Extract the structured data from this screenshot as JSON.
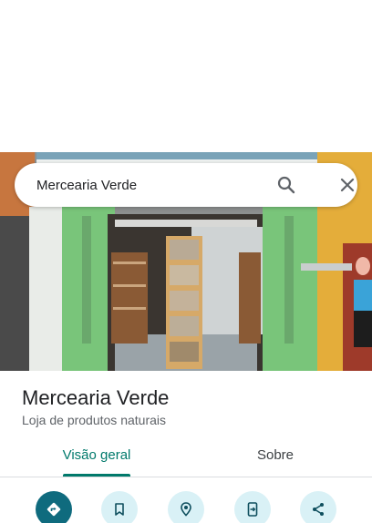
{
  "search": {
    "query": "Mercearia Verde"
  },
  "place": {
    "name": "Mercearia Verde",
    "category": "Loja de produtos naturais"
  },
  "tabs": [
    {
      "label": "Visão geral",
      "active": true
    },
    {
      "label": "Sobre",
      "active": false
    }
  ],
  "actions": [
    {
      "icon": "directions-icon"
    },
    {
      "icon": "save-bookmark-icon"
    },
    {
      "icon": "nearby-pin-icon"
    },
    {
      "icon": "send-to-phone-icon"
    },
    {
      "icon": "share-icon"
    }
  ],
  "colors": {
    "accent": "#00796b",
    "primary_action": "#0f6b7e",
    "action_background": "#d9f1f6",
    "storefront_green": "#6fbf73"
  }
}
